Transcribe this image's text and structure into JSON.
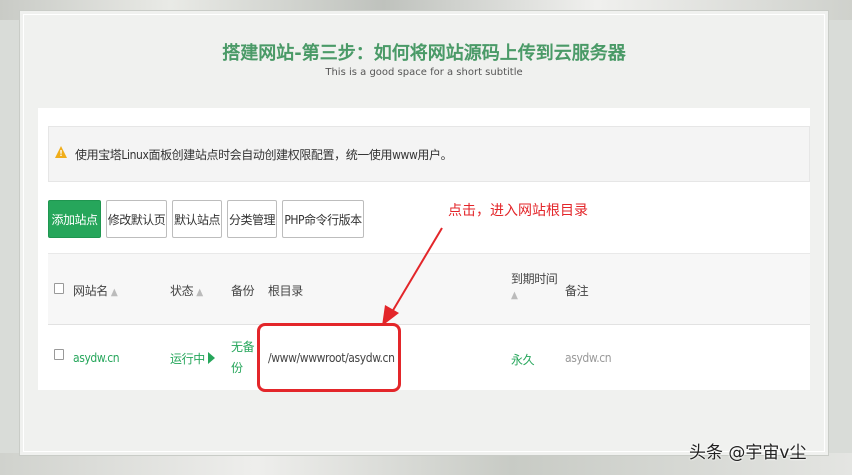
{
  "header": {
    "title": "搭建网站-第三步：如何将网站源码上传到云服务器",
    "subtitle": "This is a good space for a short subtitle"
  },
  "notice": {
    "icon": "warning-icon",
    "text": "使用宝塔Linux面板创建站点时会自动创建权限配置，统一使用www用户。"
  },
  "toolbar": {
    "buttons": [
      "添加站点",
      "修改默认页",
      "默认站点",
      "分类管理",
      "PHP命令行版本"
    ]
  },
  "table": {
    "headers": {
      "name": "网站名",
      "status": "状态",
      "backup": "备份",
      "root": "根目录",
      "expire_line1": "到期时间",
      "note": "备注"
    },
    "sort_glyph": "▲",
    "rows": [
      {
        "name": "asydw.cn",
        "status": "运行中",
        "backup_line1": "无备",
        "backup_line2": "份",
        "root": "/www/wwwroot/asydw.cn",
        "expire": "永久",
        "note": "asydw.cn"
      }
    ]
  },
  "annotation": {
    "text": "点击，进入网站根目录",
    "color": "#e3262a"
  },
  "watermark": "头条 @宇宙v尘",
  "colors": {
    "accent_green": "#26a65b",
    "title_green": "#4a9a67",
    "warning": "#f0ad1a"
  }
}
